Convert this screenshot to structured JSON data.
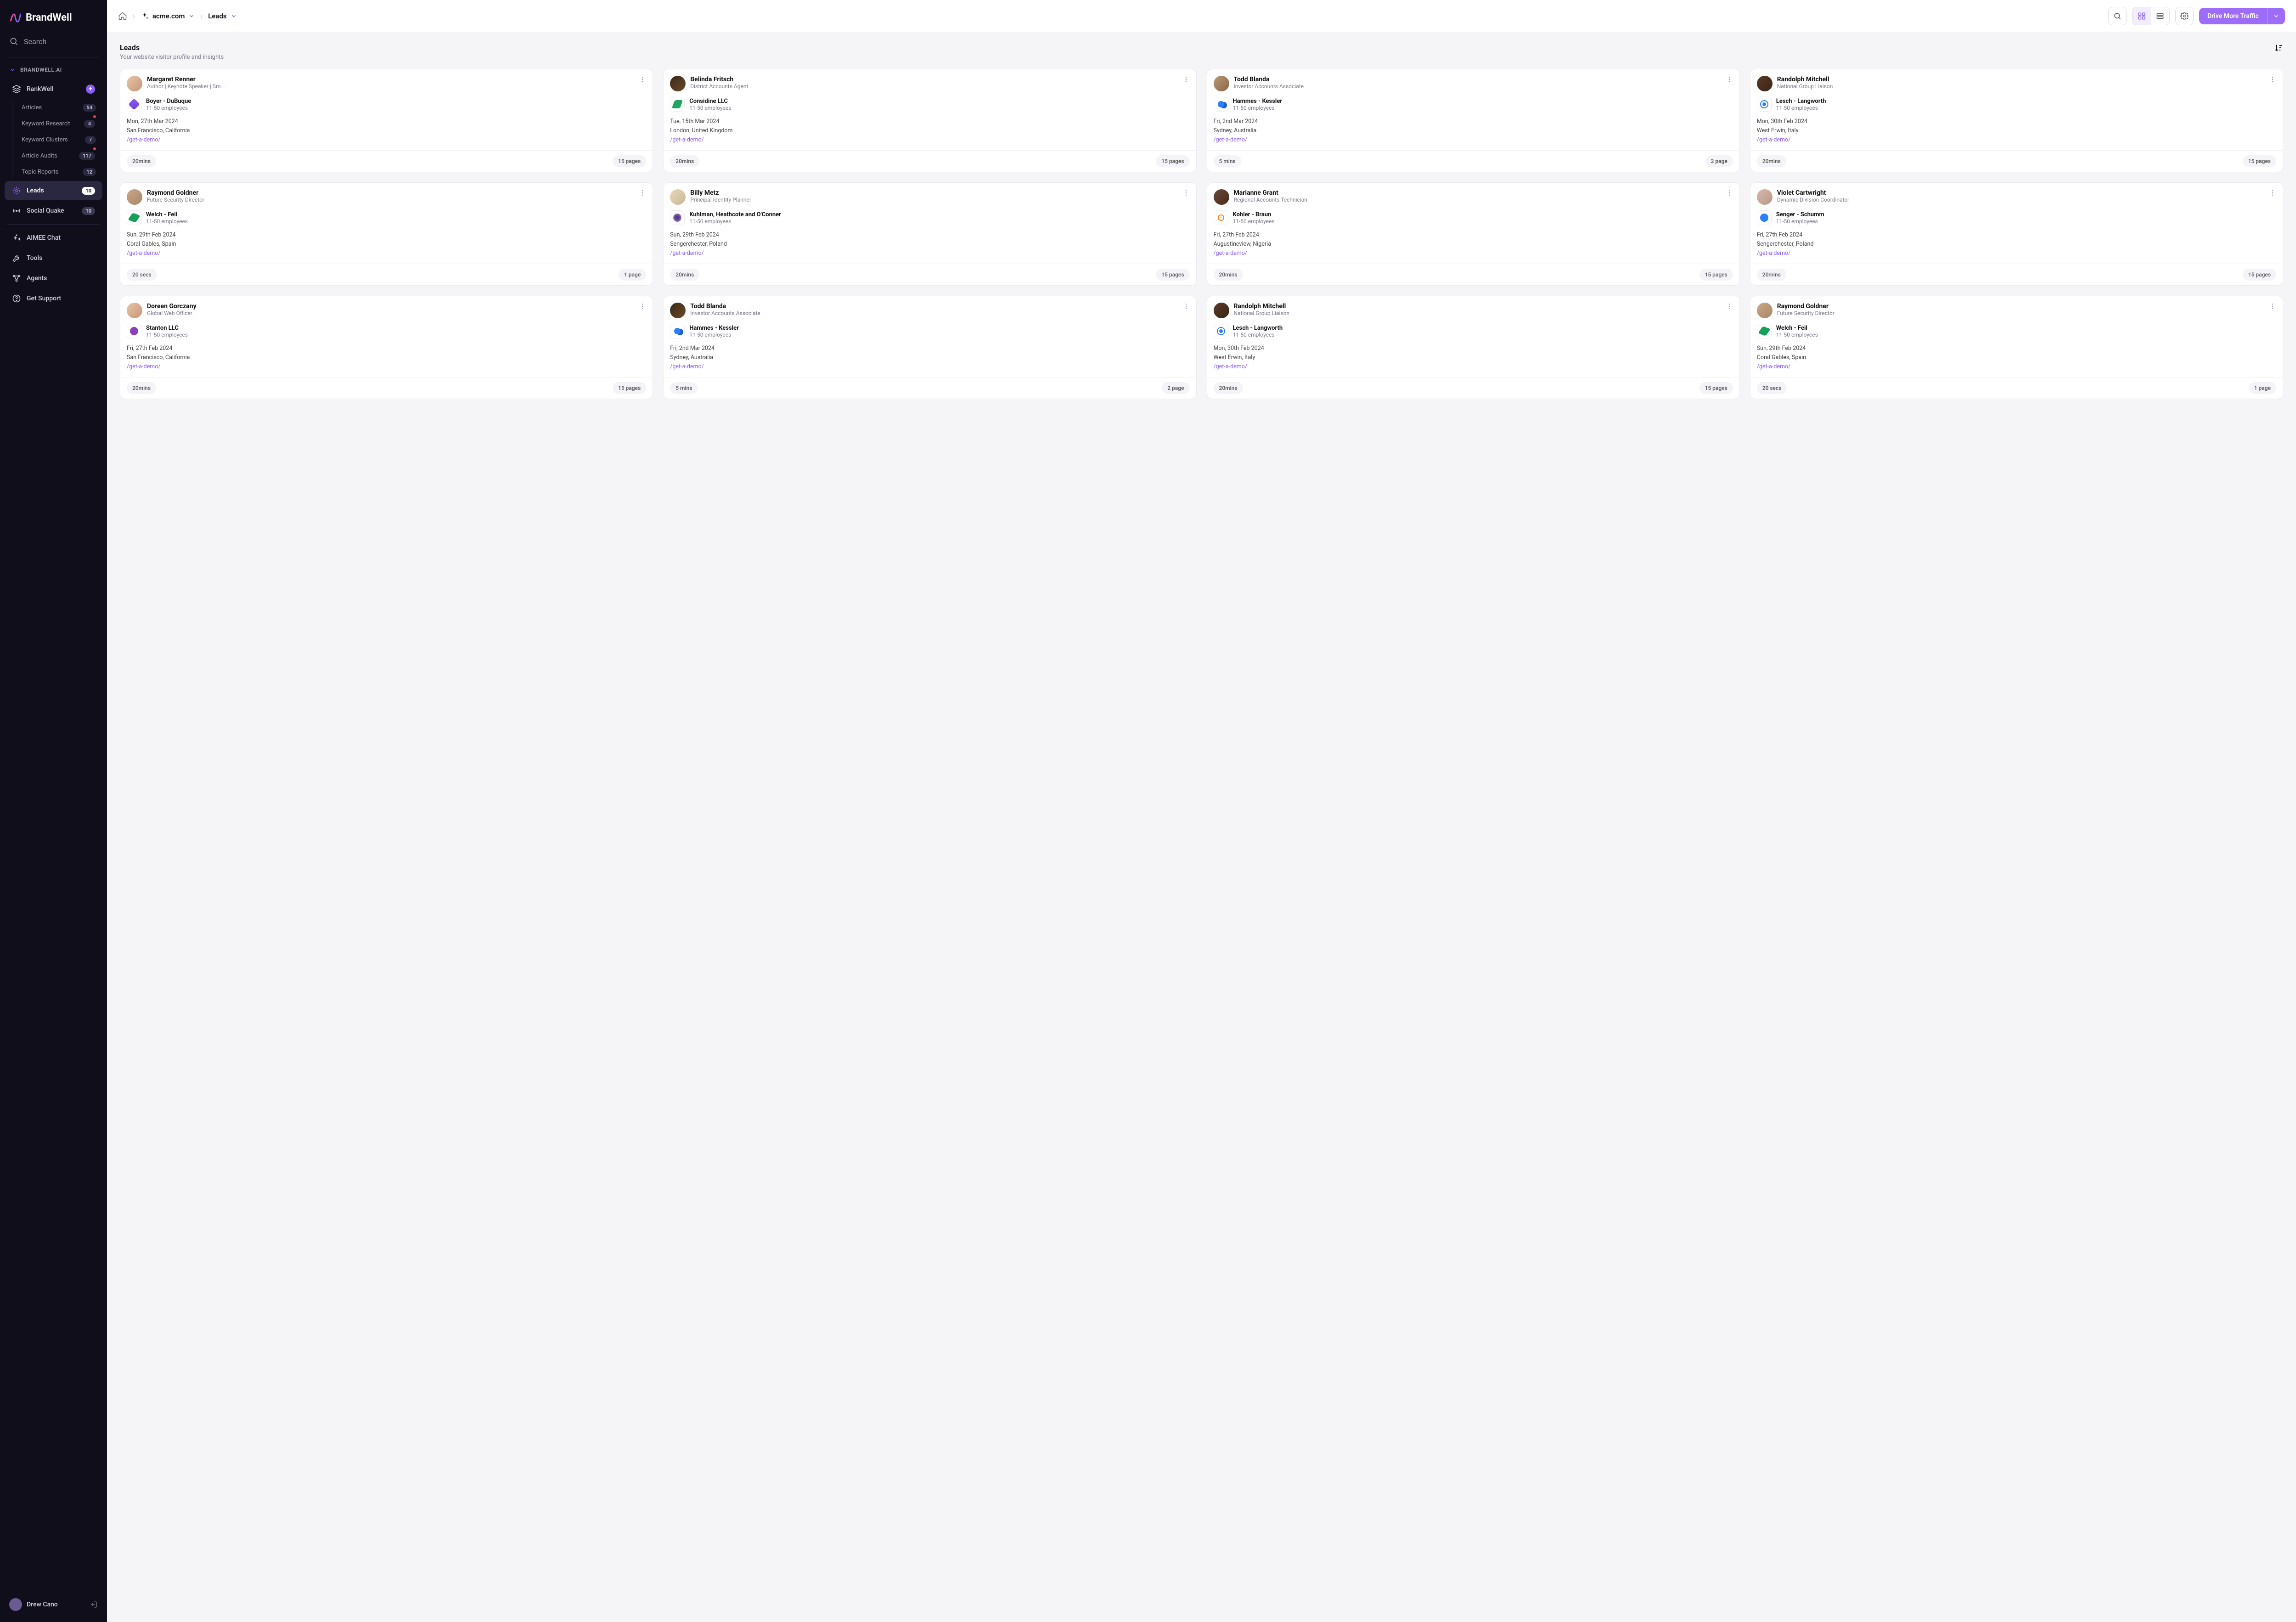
{
  "brand": "BrandWell",
  "search_label": "Search",
  "section_label": "BRANDWELL.AI",
  "nav": {
    "rankwell": "RankWell",
    "articles": {
      "label": "Articles",
      "count": "54"
    },
    "keyword_research": {
      "label": "Keyword Research",
      "count": "4"
    },
    "keyword_clusters": {
      "label": "Keyword Clusters",
      "count": "7"
    },
    "article_audits": {
      "label": "Article Audits",
      "count": "117"
    },
    "topic_reports": {
      "label": "Topic Reports",
      "count": "12"
    },
    "leads": {
      "label": "Leads",
      "count": "10"
    },
    "social_quake": {
      "label": "Social Quake",
      "count": "10"
    },
    "aimee": "AIMEE Chat",
    "tools": "Tools",
    "agents": "Agents",
    "support": "Get Support"
  },
  "user": "Drew Cano",
  "breadcrumb": {
    "site": "acme.com",
    "leaf": "Leads"
  },
  "cta": "Drive More Traffic",
  "page": {
    "title": "Leads",
    "subtitle": "Your website visitor profile and insights"
  },
  "leads": [
    {
      "name": "Margaret Renner",
      "role": "Author | Keynote Speaker | Sm...",
      "company": "Boyer - DuBuque",
      "size": "11-50 employees",
      "date": "Mon, 27th Mar 2024",
      "loc": "San Francisco, California",
      "path": "/get-a-demo/",
      "time": "20mins",
      "pages": "15 pages",
      "logo": 0,
      "av": 0
    },
    {
      "name": "Belinda Fritsch",
      "role": "District Accounts Agent",
      "company": "Considine LLC",
      "size": "11-50 employees",
      "date": "Tue, 15th Mar 2024",
      "loc": "London, United Kingdom",
      "path": "/get-a-demo/",
      "time": "20mins",
      "pages": "15 pages",
      "logo": 1,
      "av": 1
    },
    {
      "name": "Todd Blanda",
      "role": "Investor Accounts Associate",
      "company": "Hammes - Kessler",
      "size": "11-50 employees",
      "date": "Fri, 2nd Mar 2024",
      "loc": "Sydney, Australia",
      "path": "/get-a-demo/",
      "time": "5 mins",
      "pages": "2 page",
      "logo": 2,
      "av": 2
    },
    {
      "name": "Randolph Mitchell",
      "role": "National Group Liaison",
      "company": "Lesch - Langworth",
      "size": "11-50 employees",
      "date": "Mon, 30th Feb 2024",
      "loc": "West Erwin, Italy",
      "path": "/get-a-demo/",
      "time": "20mins",
      "pages": "15 pages",
      "logo": 3,
      "av": 3
    },
    {
      "name": "Raymond Goldner",
      "role": "Future Security Director",
      "company": "Welch - Feil",
      "size": "11-50 employees",
      "date": "Sun, 29th Feb 2024",
      "loc": "Coral Gables, Spain",
      "path": "/get-a-demo/",
      "time": "20 secs",
      "pages": "1 page",
      "logo": 4,
      "av": 4
    },
    {
      "name": "Billy Metz",
      "role": "Principal Identity Planner",
      "company": "Kuhlman, Heathcote and O'Conner",
      "size": "11-50 employees",
      "date": "Sun, 29th Feb 2024",
      "loc": "Sengerchester, Poland",
      "path": "/get-a-demo/",
      "time": "20mins",
      "pages": "15 pages",
      "logo": 5,
      "av": 5
    },
    {
      "name": "Marianne Grant",
      "role": "Regional Accounts Technician",
      "company": "Kohler - Braun",
      "size": "11-50 employees",
      "date": "Fri, 27th Feb 2024",
      "loc": "Augustineview, Nigeria",
      "path": "/get-a-demo/",
      "time": "20mins",
      "pages": "15 pages",
      "logo": 6,
      "av": 6
    },
    {
      "name": "Violet Cartwright",
      "role": "Dynamic Division Coordinator",
      "company": "Senger - Schumm",
      "size": "11-50 employees",
      "date": "Fri, 27th Feb 2024",
      "loc": "Sengerchester, Poland",
      "path": "/get-a-demo/",
      "time": "20mins",
      "pages": "15 pages",
      "logo": 7,
      "av": 7
    },
    {
      "name": "Doreen Gorczany",
      "role": "Global Web Officer",
      "company": "Stanton LLC",
      "size": "11-50 employees",
      "date": "Fri, 27th Feb 2024",
      "loc": "San Francisco, California",
      "path": "/get-a-demo/",
      "time": "20mins",
      "pages": "15 pages",
      "logo": 8,
      "av": 0
    },
    {
      "name": "Todd Blanda",
      "role": "Investor Accounts Associate",
      "company": "Hammes - Kessler",
      "size": "11-50 employees",
      "date": "Fri, 2nd Mar 2024",
      "loc": "Sydney, Australia",
      "path": "/get-a-demo/",
      "time": "5 mins",
      "pages": "2 page",
      "logo": 2,
      "av": 1
    },
    {
      "name": "Randolph Mitchell",
      "role": "National Group Liaison",
      "company": "Lesch - Langworth",
      "size": "11-50 employees",
      "date": "Mon, 30th Feb 2024",
      "loc": "West Erwin, Italy",
      "path": "/get-a-demo/",
      "time": "20mins",
      "pages": "15 pages",
      "logo": 3,
      "av": 3
    },
    {
      "name": "Raymond Goldner",
      "role": "Future Security Director",
      "company": "Welch - Feil",
      "size": "11-50 employees",
      "date": "Sun, 29th Feb 2024",
      "loc": "Coral Gables, Spain",
      "path": "/get-a-demo/",
      "time": "20 secs",
      "pages": "1 page",
      "logo": 4,
      "av": 4
    }
  ]
}
